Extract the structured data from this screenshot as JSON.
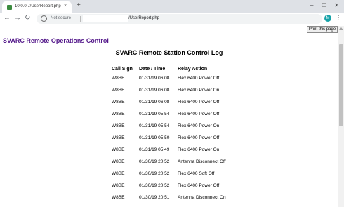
{
  "browser": {
    "tab_title": "10.0.0.7/UserReport.php",
    "tab_close": "×",
    "new_tab": "+",
    "window_controls": [
      "–",
      "☐",
      "✕"
    ],
    "nav": {
      "back": "←",
      "forward": "→",
      "reload": "↻"
    },
    "security_label": "Not secure",
    "url_path": "/UserReport.php",
    "star": "☆",
    "avatar_initial": "M",
    "menu": "⋮"
  },
  "page": {
    "print_button": "Print this page",
    "site_link": "SVARC Remote Operations Control",
    "title": "SVARC Remote Station Control Log",
    "columns": [
      "Call Sign",
      "Date / Time",
      "Relay Action"
    ],
    "rows": [
      [
        "W8BE",
        "01/31/19 06:08",
        "Flex 6400 Power Off"
      ],
      [
        "W8BE",
        "01/31/19 06:08",
        "Flex 6400 Power On"
      ],
      [
        "W8BE",
        "01/31/19 06:08",
        "Flex 6400 Power Off"
      ],
      [
        "W8BE",
        "01/31/19 05:54",
        "Flex 6400 Power Off"
      ],
      [
        "W8BE",
        "01/31/19 05:54",
        "Flex 6400 Power On"
      ],
      [
        "W8BE",
        "01/31/19 05:50",
        "Flex 6400 Power Off"
      ],
      [
        "W8BE",
        "01/31/19 05:49",
        "Flex 6400 Power On"
      ],
      [
        "W8BE",
        "01/30/19 20:52",
        "Antenna Disconnect Off"
      ],
      [
        "W8BE",
        "01/30/19 20:52",
        "Flex 6400 Soft Off"
      ],
      [
        "W8BE",
        "01/30/19 20:52",
        "Flex 6400 Power Off"
      ],
      [
        "W8BE",
        "01/30/19 20:51",
        "Antenna Disconnect On"
      ]
    ]
  }
}
